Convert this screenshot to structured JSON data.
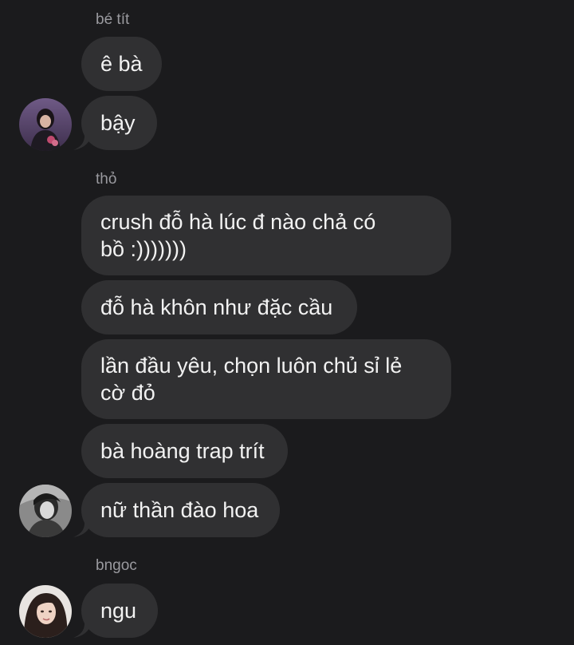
{
  "groups": [
    {
      "sender": "bé tít",
      "messages": [
        "ê bà",
        "bậy"
      ]
    },
    {
      "sender": "thỏ",
      "messages": [
        "crush đỗ hà lúc đ nào chả có\nbồ :)))))))",
        "đỗ hà khôn như đặc cầu",
        "lần đầu yêu, chọn luôn chủ sỉ lẻ\ncờ đỏ",
        "bà hoàng trap trít",
        "nữ thần đào hoa"
      ]
    },
    {
      "sender": "bngoc",
      "messages": [
        "ngu"
      ]
    }
  ],
  "colors": {
    "background": "#1b1b1d",
    "bubble": "#303032",
    "sender_name": "#9a9a9f",
    "text": "#f2f2f2"
  }
}
